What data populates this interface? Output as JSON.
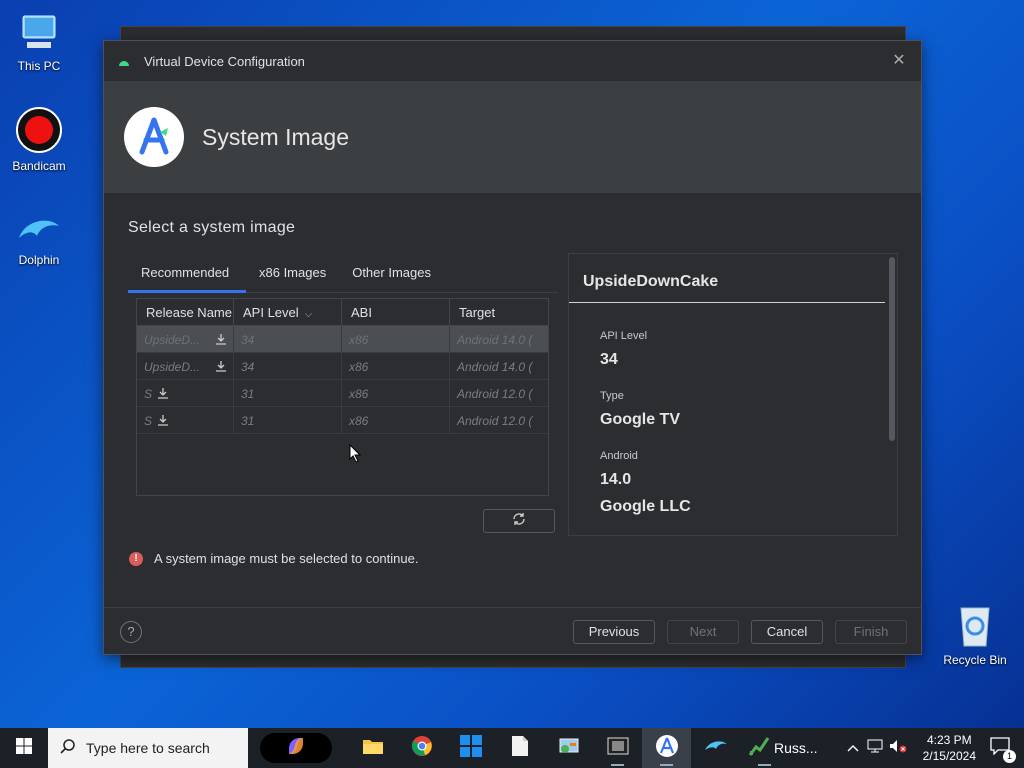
{
  "desktop": {
    "icons": [
      {
        "label": "This PC"
      },
      {
        "label": "Bandicam"
      },
      {
        "label": "Dolphin"
      },
      {
        "label": "Recycle Bin"
      }
    ]
  },
  "dialog": {
    "window_title": "Virtual Device Configuration",
    "header_title": "System Image",
    "section_title": "Select a system image",
    "tabs": [
      {
        "label": "Recommended",
        "active": true
      },
      {
        "label": "x86 Images",
        "active": false
      },
      {
        "label": "Other Images",
        "active": false
      }
    ],
    "table": {
      "columns": [
        "Release Name",
        "API Level",
        "ABI",
        "Target"
      ],
      "sort_indicator": "chevron-down",
      "rows": [
        {
          "name": "UpsideD...",
          "api": "34",
          "abi": "x86",
          "target": "Android 14.0 (",
          "selected": true
        },
        {
          "name": "UpsideD...",
          "api": "34",
          "abi": "x86",
          "target": "Android 14.0 (",
          "selected": false
        },
        {
          "name": "S",
          "api": "31",
          "abi": "x86",
          "target": "Android 12.0 (",
          "selected": false
        },
        {
          "name": "S",
          "api": "31",
          "abi": "x86",
          "target": "Android 12.0 (",
          "selected": false
        }
      ]
    },
    "details": {
      "title": "UpsideDownCake",
      "api_level_label": "API Level",
      "api_level_value": "34",
      "type_label": "Type",
      "type_value": "Google TV",
      "android_label": "Android",
      "android_value": "14.0",
      "vendor_value": "Google LLC"
    },
    "error_message": "A system image must be selected to continue.",
    "buttons": {
      "help": "?",
      "previous": "Previous",
      "next": "Next",
      "cancel": "Cancel",
      "finish": "Finish"
    }
  },
  "taskbar": {
    "search_placeholder": "Type here to search",
    "running_app_label": "Russ...",
    "time": "4:23 PM",
    "date": "2/15/2024",
    "notification_count": "1"
  },
  "colors": {
    "accent": "#3574f0",
    "error": "#db5c5c",
    "dialog_bg": "#2b2d30",
    "header_bg": "#3c3f41"
  }
}
